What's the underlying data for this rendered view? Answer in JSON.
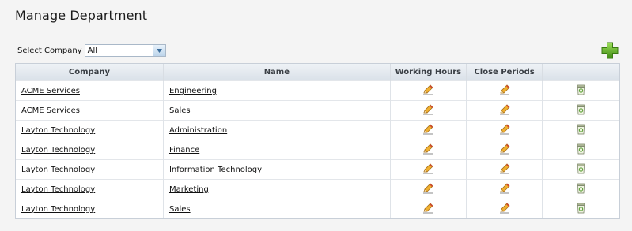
{
  "page": {
    "title": "Manage Department"
  },
  "filter": {
    "label": "Select Company",
    "selected": "All"
  },
  "table": {
    "headers": [
      "Company",
      "Name",
      "Working Hours",
      "Close Periods",
      ""
    ],
    "rows": [
      {
        "company": "ACME Services",
        "name": "Engineering"
      },
      {
        "company": "ACME Services",
        "name": "Sales"
      },
      {
        "company": "Layton Technology",
        "name": "Administration"
      },
      {
        "company": "Layton Technology",
        "name": "Finance"
      },
      {
        "company": "Layton Technology",
        "name": "Information Technology"
      },
      {
        "company": "Layton Technology",
        "name": "Marketing"
      },
      {
        "company": "Layton Technology",
        "name": "Sales"
      }
    ]
  },
  "icons": {
    "add": "add-plus-icon",
    "working_hours": "pencil-edit-icon",
    "close_periods": "pencil-edit-icon",
    "delete": "trash-icon"
  },
  "colors": {
    "add_green": "#5aa820",
    "pencil_orange": "#e8a020"
  }
}
